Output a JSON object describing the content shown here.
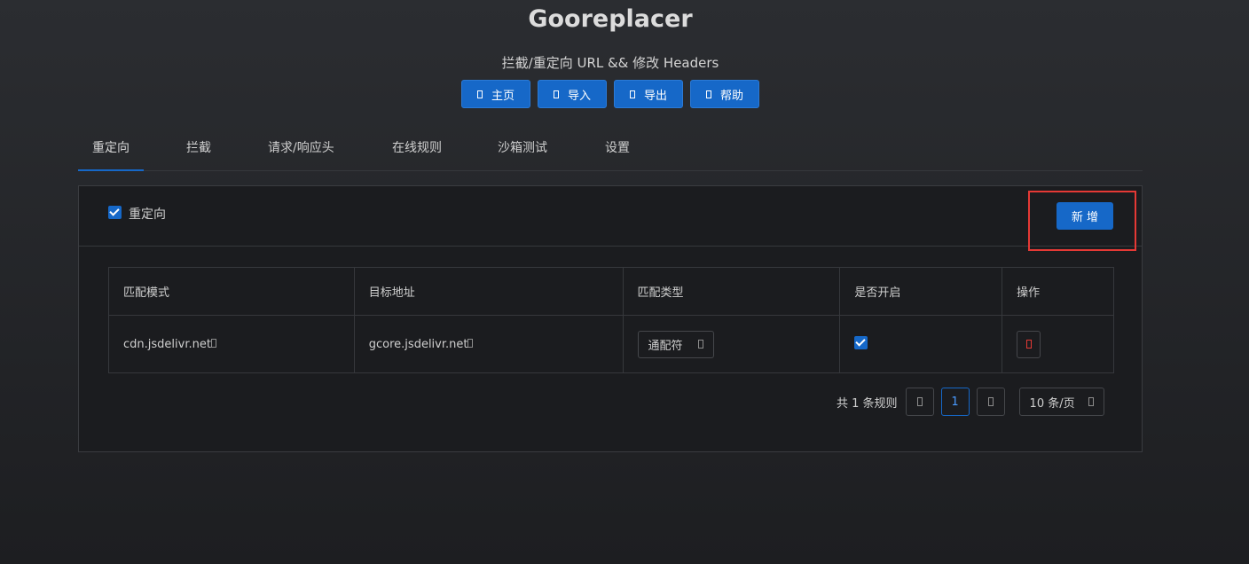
{
  "app": {
    "title": "Gooreplacer",
    "subtitle": "拦截/重定向 URL && 修改 Headers"
  },
  "top_buttons": [
    {
      "label": "主页",
      "icon": "home-icon"
    },
    {
      "label": "导入",
      "icon": "import-icon"
    },
    {
      "label": "导出",
      "icon": "export-icon"
    },
    {
      "label": "帮助",
      "icon": "help-icon"
    }
  ],
  "tabs": [
    {
      "label": "重定向",
      "active": true
    },
    {
      "label": "拦截"
    },
    {
      "label": "请求/响应头"
    },
    {
      "label": "在线规则"
    },
    {
      "label": "沙箱测试"
    },
    {
      "label": "设置"
    }
  ],
  "panel": {
    "enable_label": "重定向",
    "enabled": true,
    "add_label": "新 增"
  },
  "table": {
    "headers": [
      "匹配模式",
      "目标地址",
      "匹配类型",
      "是否开启",
      "操作"
    ],
    "rows": [
      {
        "pattern": "cdn.jsdelivr.net",
        "target": "gcore.jsdelivr.net",
        "match_type": "通配符",
        "enabled": true
      }
    ]
  },
  "pagination": {
    "total_text": "共 1 条规则",
    "current_page": "1",
    "page_size": "10 条/页"
  },
  "colors": {
    "accent": "#1668c8",
    "highlight": "#e53935"
  }
}
